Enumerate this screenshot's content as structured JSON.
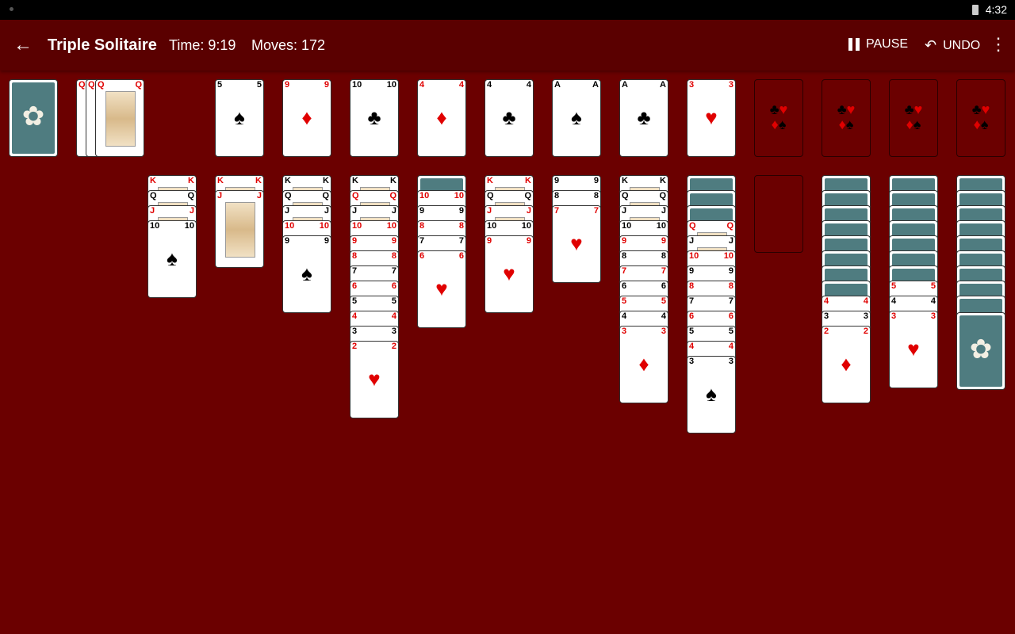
{
  "status": {
    "time": "4:32"
  },
  "appbar": {
    "title": "Triple Solitaire",
    "timer": "Time: 9:19",
    "moves": "Moves: 172",
    "pause_label": "PAUSE",
    "undo_label": "UNDO"
  },
  "colors": {
    "felt": "#6b0000",
    "appbar": "#5a0000",
    "red_suit": "#e00000"
  },
  "icons": {
    "back": "arrow-left-icon",
    "pause": "pause-icon",
    "undo": "undo-icon",
    "more": "more-vert-icon"
  },
  "cards": {
    "waste": [
      "Q♦",
      "Q♦",
      "Q♦"
    ],
    "top_row": [
      "5♠",
      "9♦",
      "10♣",
      "4♦",
      "4♣",
      "A♠",
      "A♣",
      "3♥"
    ],
    "tableau": [
      [
        "K♦",
        "Q♠",
        "J♦",
        "10♠"
      ],
      [
        "K♥",
        "J♦"
      ],
      [
        "K♠",
        "Q♠",
        "J♠",
        "10♦",
        "9♠"
      ],
      [
        "K♣",
        "Q♦",
        "J♣",
        "10♥",
        "9♥",
        "8♥",
        "7♣",
        "6♥",
        "5♣",
        "4♦",
        "3♠",
        "2♥"
      ],
      [
        "10♥",
        "9♠",
        "8♦",
        "7♣",
        "6♥"
      ],
      [
        "K♦",
        "Q♣",
        "J♥",
        "10♠",
        "9♥"
      ],
      [
        "9♠",
        "8♣",
        "7♥"
      ],
      [
        "K♣",
        "Q♣",
        "J♣",
        "10♠",
        "9♥",
        "8♠",
        "7♥",
        "6♣",
        "5♥",
        "4♠",
        "3♦"
      ],
      [
        "Q♦",
        "J♣",
        "10♦",
        "9♣",
        "8♦",
        "7♣",
        "6♦",
        "5♣",
        "4♦",
        "3♠"
      ],
      [],
      [
        "4♥",
        "3♣",
        "2♦"
      ],
      [
        "5♥",
        "4♠",
        "3♥"
      ],
      []
    ]
  }
}
